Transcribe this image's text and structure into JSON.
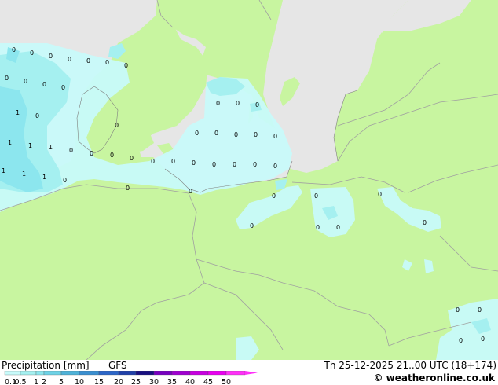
{
  "legend": {
    "title": "Precipitation [mm]",
    "model": "GFS",
    "ticks": [
      "0.1",
      "0.5",
      "1",
      "2",
      "5",
      "10",
      "15",
      "20",
      "25",
      "30",
      "35",
      "40",
      "45",
      "50"
    ],
    "colors": [
      "#c8fafa",
      "#a5f0f0",
      "#8ce6ee",
      "#6ed2e6",
      "#4fb2d8",
      "#3a8fd0",
      "#2c66c8",
      "#2040a8",
      "#180f80",
      "#7800c0",
      "#a000d0",
      "#c800e0",
      "#e800f0",
      "#ff30f8"
    ]
  },
  "datetime": "Th 25-12-2025 21..00 UTC (18+174)",
  "credit": "© weatheronline.co.uk",
  "map": {
    "colors": {
      "land": "#c8f5a0",
      "sea": "#e6e6e6",
      "precip_light": "#c8fafa",
      "precip_mid": "#a5f0f0",
      "precip_strong": "#8ce6ee",
      "border": "#a0a0a0"
    },
    "point_labels": [
      "0",
      "1"
    ]
  }
}
